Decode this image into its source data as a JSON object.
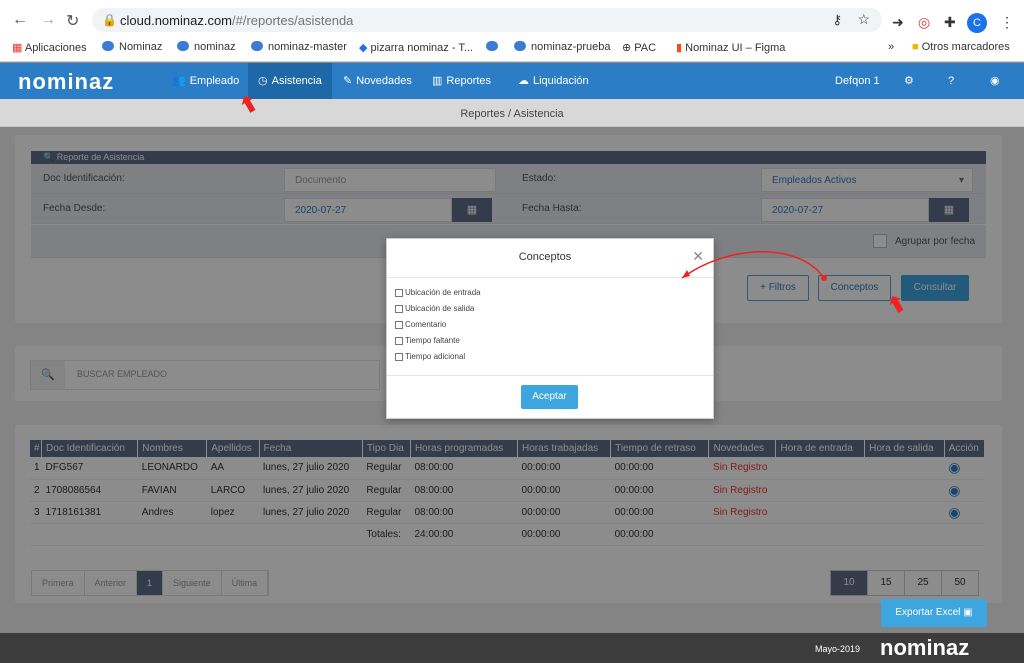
{
  "browser": {
    "url_host": "cloud.nominaz.com",
    "url_path": "/#/reportes/asistenda",
    "avatar_letter": "C",
    "bookmarks": [
      "Aplicaciones",
      "Nominaz",
      "nominaz",
      "nominaz-master",
      "pizarra nominaz - T...",
      "",
      "nominaz-prueba",
      "PAC",
      "Nominaz UI – Figma"
    ],
    "more": "»",
    "other_bookmarks": "Otros marcadores"
  },
  "nav": {
    "logo": "nominaz",
    "items": [
      "Empleado",
      "Asistencia",
      "Novedades",
      "Reportes",
      "Liquidación"
    ],
    "company": "Defqon 1"
  },
  "breadcrumb": "Reportes / Asistencia",
  "form": {
    "section_title": "Reporte de Asistencia",
    "doc_label": "Doc Identificación:",
    "doc_placeholder": "Documento",
    "estado_label": "Estado:",
    "estado_value": "Empleados Activos",
    "desde_label": "Fecha Desde:",
    "desde_value": "2020-07-27",
    "hasta_label": "Fecha Hasta:",
    "hasta_value": "2020-07-27",
    "agrupar_label": "Agrupar por fecha",
    "filtros_btn": "+ Filtros",
    "conceptos_btn": "Conceptos",
    "consultar_btn": "Consultar"
  },
  "search": {
    "placeholder": "BUSCAR EMPLEADO"
  },
  "table": {
    "headers": [
      "#",
      "Doc Identificación",
      "Nombres",
      "Apellidos",
      "Fecha",
      "Tipo Dia",
      "Horas programadas",
      "Horas trabajadas",
      "Tiempo de retraso",
      "Novedades",
      "Hora de entrada",
      "Hora de salida",
      "Acción"
    ],
    "rows": [
      [
        "1",
        "DFG567",
        "LEONARDO",
        "AA",
        "lunes, 27 julio 2020",
        "Regular",
        "08:00:00",
        "00:00:00",
        "00:00:00",
        "Sin Registro",
        "",
        ""
      ],
      [
        "2",
        "1708086564",
        "FAVIAN",
        "LARCO",
        "lunes, 27 julio 2020",
        "Regular",
        "08:00:00",
        "00:00:00",
        "00:00:00",
        "Sin Registro",
        "",
        ""
      ],
      [
        "3",
        "1718161381",
        "Andres",
        "lopez",
        "lunes, 27 julio 2020",
        "Regular",
        "08:00:00",
        "00:00:00",
        "00:00:00",
        "Sin Registro",
        "",
        ""
      ]
    ],
    "totals_label": "Totales:",
    "totals": [
      "24:00:00",
      "00:00:00",
      "00:00:00"
    ]
  },
  "pager": {
    "items": [
      "Primera",
      "Anterior",
      "1",
      "Siguiente",
      "Última"
    ],
    "sizes": [
      "10",
      "15",
      "25",
      "50"
    ]
  },
  "export_btn": "Exportar Excel",
  "footer": {
    "date": "Mayo-2019",
    "logo": "nominaz"
  },
  "modal": {
    "title": "Conceptos",
    "options": [
      "Ubicación de entrada",
      "Ubicación de salida",
      "Comentario",
      "Tiempo faltante",
      "Tiempo adicional"
    ],
    "accept": "Aceptar"
  },
  "colors": {
    "primary": "#2b7ec6",
    "header_dark": "#5f6d8b",
    "danger": "#e33"
  }
}
